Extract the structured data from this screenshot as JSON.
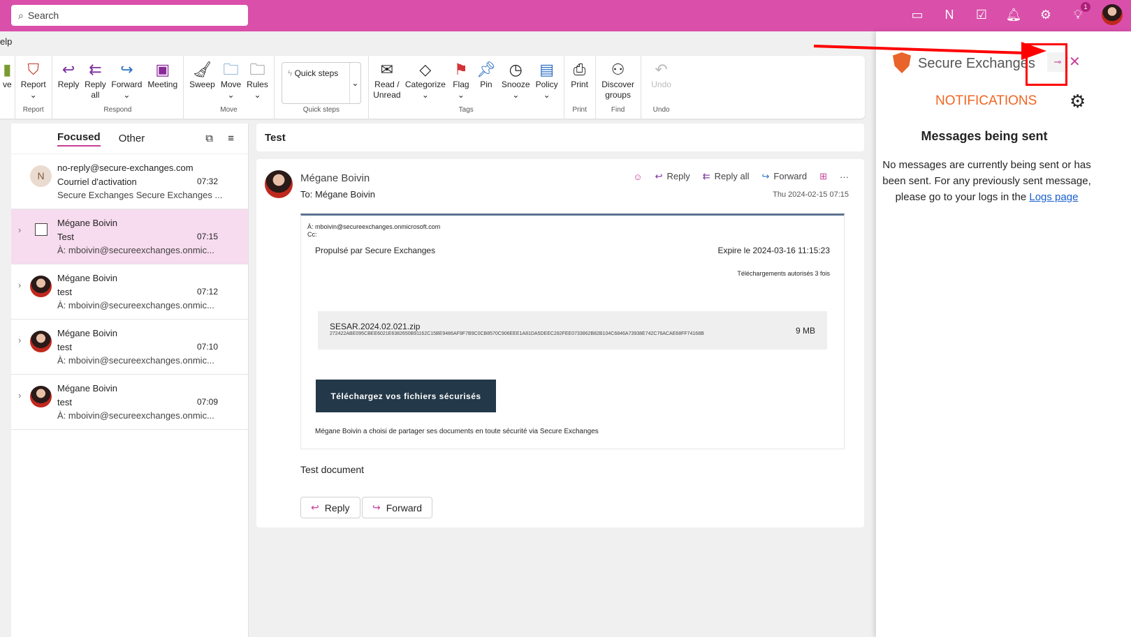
{
  "search": {
    "placeholder": "Search"
  },
  "topbar": {
    "notification_count": "1"
  },
  "menu": {
    "partial": "elp"
  },
  "ribbon": {
    "partial_label": "ve",
    "groups": [
      {
        "label": "Report",
        "buttons": [
          "Report"
        ]
      },
      {
        "label": "Respond",
        "buttons": [
          "Reply",
          "Reply all",
          "Forward",
          "Meeting"
        ]
      },
      {
        "label": "Move",
        "buttons": [
          "Sweep",
          "Move",
          "Rules"
        ]
      },
      {
        "label": "Quick steps",
        "buttons": [
          "Quick steps"
        ]
      },
      {
        "label": "Tags",
        "buttons": [
          "Read / Unread",
          "Categorize",
          "Flag",
          "Pin",
          "Snooze",
          "Policy"
        ]
      },
      {
        "label": "Print",
        "buttons": [
          "Print"
        ]
      },
      {
        "label": "Find",
        "buttons": [
          "Discover groups"
        ]
      },
      {
        "label": "Undo",
        "buttons": [
          "Undo"
        ]
      }
    ]
  },
  "list": {
    "tabs": [
      "Focused",
      "Other"
    ],
    "items": [
      {
        "initial": "N",
        "from": "no-reply@secure-exchanges.com",
        "subject": "Courriel d'activation",
        "time": "07:32",
        "preview": "Secure Exchanges Secure Exchanges ..."
      },
      {
        "from": "Mégane Boivin",
        "subject": "Test",
        "time": "07:15",
        "preview": "À: mboivin@secureexchanges.onmic..."
      },
      {
        "from": "Mégane Boivin",
        "subject": "test",
        "time": "07:12",
        "preview": "À: mboivin@secureexchanges.onmic..."
      },
      {
        "from": "Mégane Boivin",
        "subject": "test",
        "time": "07:10",
        "preview": "À: mboivin@secureexchanges.onmic..."
      },
      {
        "from": "Mégane Boivin",
        "subject": "test",
        "time": "07:09",
        "preview": "À: mboivin@secureexchanges.onmic..."
      }
    ]
  },
  "reading": {
    "subject": "Test",
    "sender": "Mégane Boivin",
    "to": "To:  Mégane Boivin",
    "date": "Thu 2024-02-15 07:15",
    "actions": {
      "reply": "Reply",
      "reply_all": "Reply all",
      "forward": "Forward"
    },
    "body": {
      "to_line": "À: mboivin@secureexchanges.onmicrosoft.com",
      "cc_line": "Cc:",
      "powered": "Propulsé par Secure Exchanges",
      "expires": "Expire le 2024-03-16 11:15:23",
      "downloads": "Téléchargements autorisés 3 fois",
      "file_name": "SESAR.2024.02.021.zip",
      "file_hash": "272422ABE095CBEE6021E6382650B91162C15BE9486AF9F7B9C0CB8570C906EEE1A81DA5DEEC282FEE0733862B82B104C6846A73938E742C76ACAE68FF74168B",
      "file_size": "9 MB",
      "download_button": "Téléchargez vos fichiers sécurisés",
      "footer": "Mégane Boivin a choisi de partager ses documents en toute sécurité via Secure Exchanges"
    },
    "text": "Test document",
    "bottom_reply": "Reply",
    "bottom_forward": "Forward"
  },
  "addin": {
    "title": "Secure Exchanges",
    "heading": "NOTIFICATIONS",
    "subheading": "Messages being sent",
    "message": "No messages are currently being sent or has been sent. For any previously sent message, please go to your logs in the ",
    "link": "Logs page"
  }
}
